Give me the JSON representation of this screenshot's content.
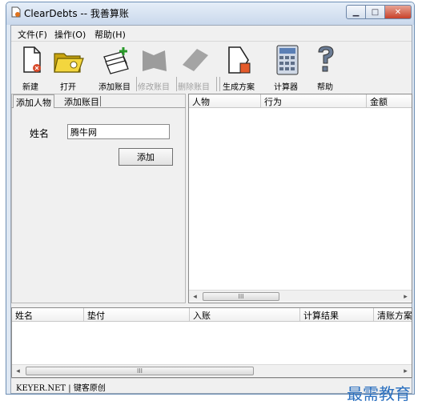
{
  "window": {
    "title": "ClearDebts -- 我善算账"
  },
  "menu": [
    "文件(F)",
    "操作(O)",
    "帮助(H)"
  ],
  "toolbar": {
    "items": [
      {
        "label": "新建",
        "icon": "new-file-icon",
        "enabled": true
      },
      {
        "label": "打开",
        "icon": "folder-open-icon",
        "enabled": true
      },
      {
        "label": "添加账目",
        "icon": "add-entry-icon",
        "enabled": true
      },
      {
        "label": "修改账目",
        "icon": "edit-entry-icon",
        "enabled": false
      },
      {
        "label": "删除账目",
        "icon": "delete-entry-icon",
        "enabled": false
      },
      {
        "label": "生成方案",
        "icon": "generate-plan-icon",
        "enabled": true
      },
      {
        "label": "计算器",
        "icon": "calculator-icon",
        "enabled": true
      },
      {
        "label": "帮助",
        "icon": "help-icon",
        "enabled": true
      }
    ]
  },
  "left_panel": {
    "tabs": [
      "添加人物",
      "添加账目"
    ],
    "name_label": "姓名",
    "name_value": "腾牛网",
    "add_button": "添加"
  },
  "right_list": {
    "columns": [
      "人物",
      "行为",
      "金额"
    ]
  },
  "bottom_list": {
    "columns": [
      "姓名",
      "垫付",
      "入账",
      "计算结果",
      "清账方案"
    ]
  },
  "scroll_thumb_label": "III",
  "status": "KEYER.NET | 键客原创",
  "watermark": "最需教育",
  "colors": {
    "titlebar": "#c9d8ec",
    "close_button": "#c8412a",
    "disabled_text": "#a0a0a0"
  }
}
